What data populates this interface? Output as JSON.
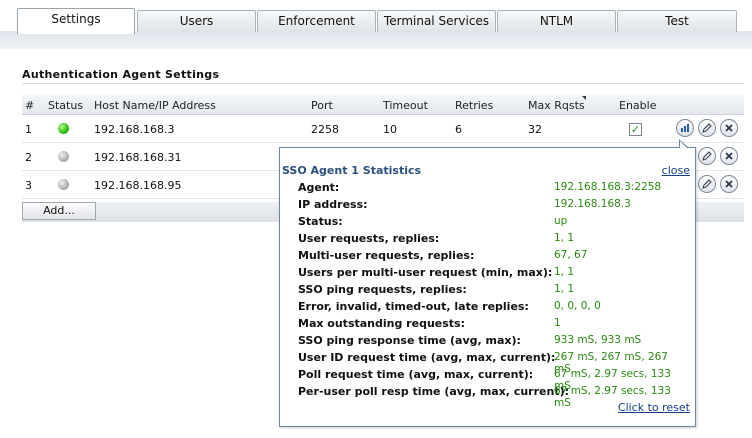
{
  "tabs": [
    {
      "label": "Settings",
      "active": true
    },
    {
      "label": "Users"
    },
    {
      "label": "Enforcement"
    },
    {
      "label": "Terminal Services"
    },
    {
      "label": "NTLM"
    },
    {
      "label": "Test"
    }
  ],
  "section": {
    "title": "Authentication Agent Settings"
  },
  "table": {
    "headers": {
      "num": "#",
      "status": "Status",
      "host": "Host Name/IP Address",
      "port": "Port",
      "timeout": "Timeout",
      "retries": "Retries",
      "maxrqsts": "Max Rqsts",
      "enable": "Enable"
    },
    "rows": [
      {
        "num": "1",
        "status": "green",
        "host": "192.168.168.3",
        "port": "2258",
        "timeout": "10",
        "retries": "6",
        "maxrqsts": "32",
        "enabled": "✓"
      },
      {
        "num": "2",
        "status": "gray",
        "host": "192.168.168.31"
      },
      {
        "num": "3",
        "status": "gray",
        "host": "192.168.168.95"
      }
    ],
    "add_label": "Add..."
  },
  "popup": {
    "title": "SSO Agent 1 Statistics",
    "close_label": "close",
    "stats": [
      {
        "label": "Agent:",
        "value": "192.168.168.3:2258"
      },
      {
        "label": "IP address:",
        "value": "192.168.168.3"
      },
      {
        "label": "Status:",
        "value": "up"
      },
      {
        "label": "User requests, replies:",
        "value": "1, 1"
      },
      {
        "label": "Multi-user requests, replies:",
        "value": "67, 67"
      },
      {
        "label": "Users per multi-user request (min, max):",
        "value": "1, 1"
      },
      {
        "label": "SSO ping requests, replies:",
        "value": "1, 1"
      },
      {
        "label": "Error, invalid, timed-out, late replies:",
        "value": "0, 0, 0, 0"
      },
      {
        "label": "Max outstanding requests:",
        "value": "1"
      },
      {
        "label": "SSO ping response time (avg, max):",
        "value": "933 mS, 933 mS"
      },
      {
        "label": "User ID request time (avg, max, current):",
        "value": "267 mS, 267 mS, 267 mS"
      },
      {
        "label": "Poll request time (avg, max, current):",
        "value": "67 mS, 2.97 secs, 133 mS"
      },
      {
        "label": "Per-user poll resp time (avg, max, current):",
        "value": "67 mS, 2.97 secs, 133 mS"
      }
    ],
    "reset_label": "Click to reset"
  },
  "icons": {
    "stats": "bar-chart-icon",
    "edit": "pencil-icon",
    "delete": "x-icon"
  },
  "colors": {
    "stat_value": "#2a8a10",
    "link": "#123e8a",
    "popup_title": "#2b4f7e",
    "status_up": "#2fbf18",
    "status_unknown": "#b4b4b4"
  }
}
